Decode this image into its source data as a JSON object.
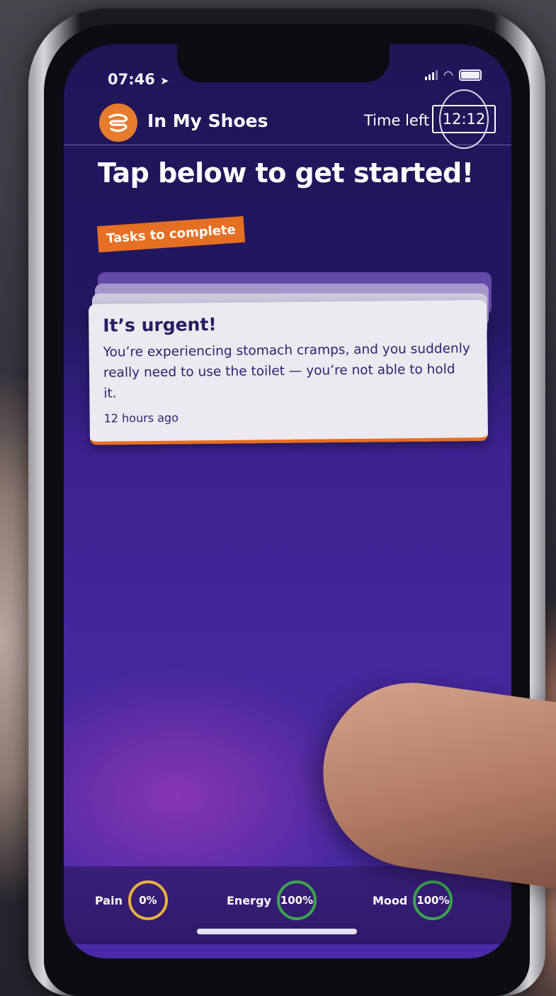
{
  "status_bar": {
    "time": "07:46"
  },
  "app": {
    "title": "In My Shoes",
    "time_left_label": "Time left",
    "time_left_value": "12:12"
  },
  "main": {
    "headline": "Tap below to get started!",
    "tasks_tag": "Tasks to complete",
    "task_card": {
      "title": "It’s urgent!",
      "body": "You’re experiencing stomach cramps, and you suddenly really need to use the toilet — you’re not able to hold it.",
      "timestamp": "12 hours ago"
    }
  },
  "stats": [
    {
      "label": "Pain",
      "value": "0%",
      "color": "#e8b23a"
    },
    {
      "label": "Energy",
      "value": "100%",
      "color": "#3aa64a"
    },
    {
      "label": "Mood",
      "value": "100%",
      "color": "#3aa64a"
    }
  ],
  "colors": {
    "accent": "#e56f22",
    "screen_bg": "#221760",
    "card_text": "#2a1b63"
  }
}
